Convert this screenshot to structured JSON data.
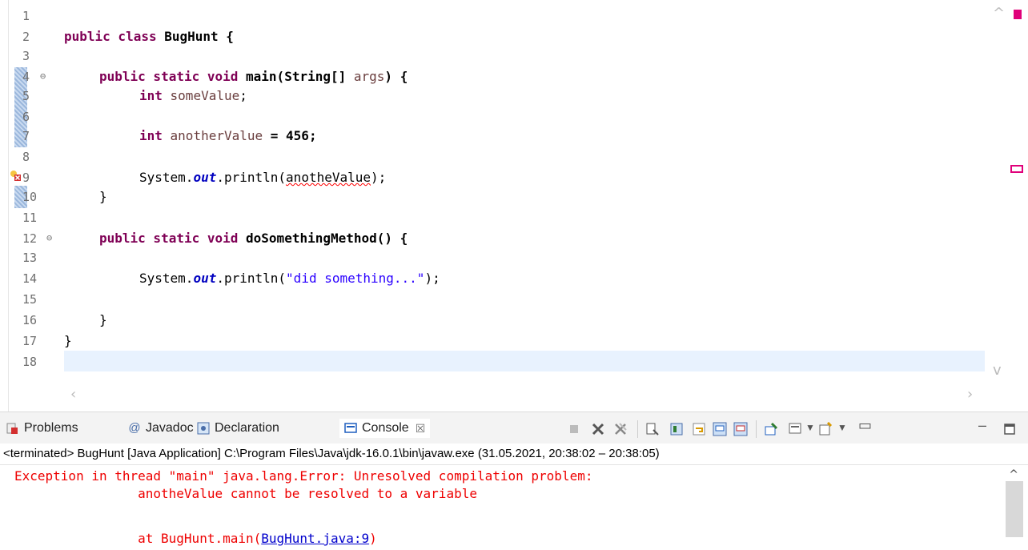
{
  "editor": {
    "line_numbers": [
      "1",
      "2",
      "3",
      "4",
      "5",
      "6",
      "7",
      "8",
      "9",
      "10",
      "11",
      "12",
      "13",
      "14",
      "15",
      "16",
      "17",
      "18"
    ],
    "lines": {
      "l2_kw": "public class",
      "l2_rest": " BugHunt {",
      "l4_kw": "public static void",
      "l4_rest": " main(String[] ",
      "l4_var": "args",
      "l4_end": ") {",
      "l5_kw": "int",
      "l5_var": " someValue",
      "l5_end": ";",
      "l7_kw": "int",
      "l7_var": " anotherValue",
      "l7_end": " = 456;",
      "l9_pre": "System.",
      "l9_field": "out",
      "l9_mid": ".println(",
      "l9_err": "anotheValue",
      "l9_end": ");",
      "l10": "}",
      "l12_kw": "public static void",
      "l12_rest": " doSomethingMethod() {",
      "l14_pre": "System.",
      "l14_field": "out",
      "l14_mid": ".println(",
      "l14_str": "\"did something...\"",
      "l14_end": ");",
      "l16": "}",
      "l17": "}"
    }
  },
  "tabs": {
    "problems": "Problems",
    "javadoc": "Javadoc",
    "declaration": "Declaration",
    "console": "Console"
  },
  "status_text": "<terminated> BugHunt [Java Application] C:\\Program Files\\Java\\jdk-16.0.1\\bin\\javaw.exe  (31.05.2021, 20:38:02 – 20:38:05)",
  "console": {
    "line1": "Exception in thread \"main\" java.lang.Error: Unresolved compilation problem: ",
    "line2": "\tanotheValue cannot be resolved to a variable",
    "line3_pre": "\tat BugHunt.main(",
    "line3_link": "BugHunt.java:9",
    "line3_end": ")"
  },
  "colors": {
    "keyword": "#7f0055",
    "string": "#2a00ff",
    "error": "#ee0000"
  }
}
